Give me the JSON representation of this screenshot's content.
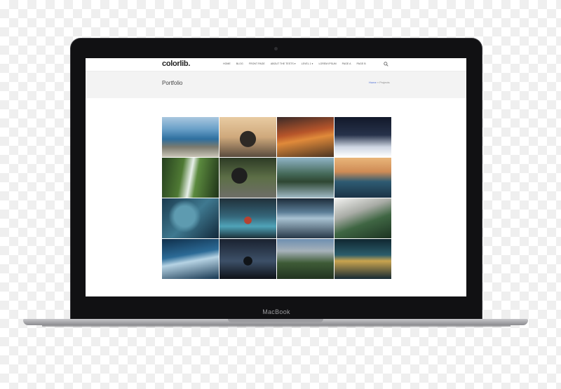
{
  "device": {
    "brand_label": "MacBook"
  },
  "site": {
    "logo": "colorlib.",
    "menu": [
      "Home",
      "Blog",
      "Front Page",
      "About the Tests ▾",
      "Level 1 ▾",
      "Lorem Ipsum",
      "Page A",
      "Page B"
    ],
    "search_icon": "search-icon"
  },
  "hero": {
    "title": "Portfolio",
    "breadcrumb_home": "Home",
    "breadcrumb_sep": " » ",
    "breadcrumb_current": "Projects"
  },
  "portfolio": {
    "tiles": [
      "fjord-cliff",
      "person-at-sea",
      "sunset-mountains",
      "snowy-cabin",
      "waterfall-valley",
      "forest-bridge",
      "mountain-lake",
      "ocean-sunset",
      "aerial-coast",
      "kayak-lake",
      "storm-clouds",
      "green-cliffs",
      "ocean-wave",
      "night-figure",
      "yosemite-valley",
      "station-corridor"
    ]
  }
}
